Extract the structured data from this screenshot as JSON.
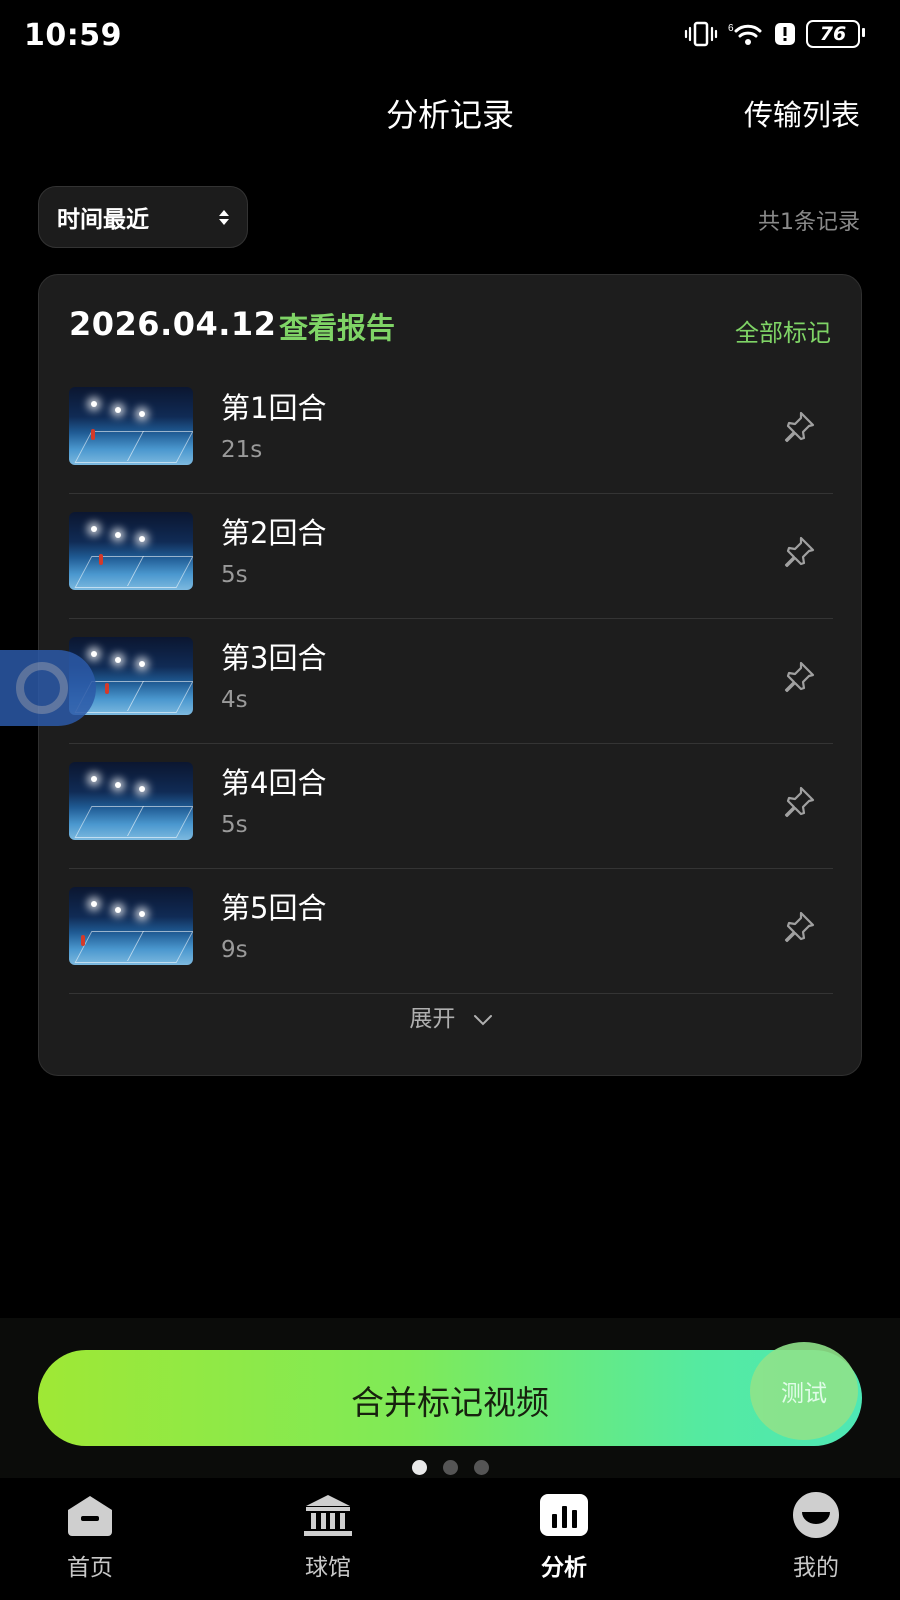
{
  "status_bar": {
    "time": "10:59",
    "battery": "76"
  },
  "header": {
    "title": "分析记录",
    "transfer_list": "传输列表"
  },
  "toolbar": {
    "sort_label": "时间最近",
    "record_count": "共1条记录"
  },
  "record": {
    "date": "2026.04.12",
    "view_report": "查看报告",
    "mark_all": "全部标记",
    "rounds": [
      {
        "name": "第1回合",
        "duration": "21s"
      },
      {
        "name": "第2回合",
        "duration": "5s"
      },
      {
        "name": "第3回合",
        "duration": "4s"
      },
      {
        "name": "第4回合",
        "duration": "5s"
      },
      {
        "name": "第5回合",
        "duration": "9s"
      }
    ],
    "expand": "展开"
  },
  "actions": {
    "merge_button": "合并标记视频",
    "test_badge": "测试"
  },
  "pager": {
    "count": 3,
    "active_index": 0
  },
  "tabs": [
    {
      "label": "首页",
      "icon": "home-icon"
    },
    {
      "label": "球馆",
      "icon": "venue-icon"
    },
    {
      "label": "分析",
      "icon": "analysis-icon"
    },
    {
      "label": "我的",
      "icon": "profile-icon"
    }
  ],
  "colors": {
    "accent_green": "#7fd466",
    "gradient_start": "#9fe835",
    "gradient_end": "#4ee8b5",
    "card_bg": "#1d1d1d"
  }
}
